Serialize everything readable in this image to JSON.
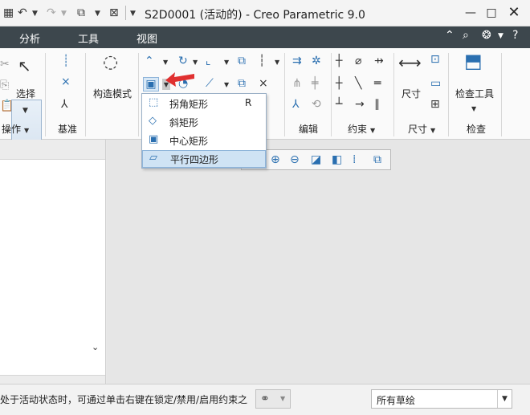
{
  "window": {
    "title": "S2D0001 (活动的) - Creo Parametric 9.0",
    "minimize_glyph": "—",
    "maximize_glyph": "□"
  },
  "menubar": {
    "tabs": [
      "分析",
      "工具",
      "视图"
    ]
  },
  "ribbon": {
    "groups": {
      "operations": "操作",
      "datum": "基准",
      "edit": "编辑",
      "constraints": "约束",
      "dimension": "尺寸",
      "inspect": "检查"
    },
    "select_label": "选择",
    "construction_mode_label": "构造模式",
    "dimension_label": "尺寸",
    "inspect_tool_label": "检查工具"
  },
  "rectangle_dropdown": {
    "items": [
      {
        "label": "拐角矩形",
        "shortcut": "R",
        "icon": "corner-rectangle-icon"
      },
      {
        "label": "斜矩形",
        "shortcut": "",
        "icon": "slanted-rectangle-icon"
      },
      {
        "label": "中心矩形",
        "shortcut": "",
        "icon": "center-rectangle-icon"
      },
      {
        "label": "平行四边形",
        "shortcut": "",
        "icon": "parallelogram-icon"
      }
    ],
    "highlighted_index": 3
  },
  "statusbar": {
    "message": "处于活动状态时，可通过单击右键在锁定/禁用/启用约束之",
    "filter_value": "所有草绘"
  },
  "colors": {
    "menubar_bg": "#3d474d",
    "accent_blue": "#2a6fb0",
    "highlight": "#cfe3f4",
    "red_arrow": "#e03030"
  }
}
